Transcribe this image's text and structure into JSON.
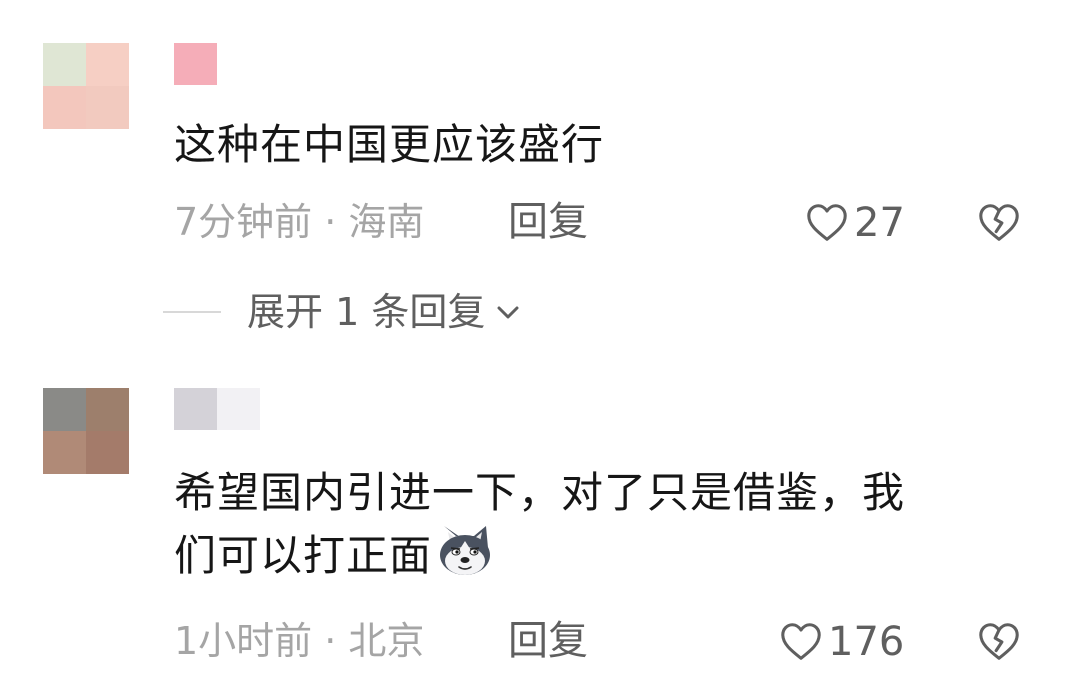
{
  "comments": [
    {
      "text": "这种在中国更应该盛行",
      "time_location": "7分钟前 · 海南",
      "reply_label": "回复",
      "like_count": "27",
      "expand_label": "展开 1 条回复",
      "avatar_colors": [
        "#dfe6d4",
        "#f6cfc4",
        "#f3c7bd",
        "#f2cabf"
      ],
      "username_colors": [
        "#f5adb8"
      ]
    },
    {
      "text_line1": "希望国内引进一下，对了只是借鉴，我",
      "text_line2": "们可以打正面",
      "time_location": "1小时前 · 北京",
      "reply_label": "回复",
      "like_count": "176",
      "avatar_colors": [
        "#8a8a87",
        "#9d7f6c",
        "#b08a77",
        "#a47b6a"
      ],
      "username_colors": [
        "#d4d2d8",
        "#f2f1f4"
      ]
    }
  ],
  "icons": {
    "like": "heart-outline-icon",
    "dislike": "broken-heart-icon",
    "expand": "chevron-down-icon",
    "emoji": "husky-dog-emoji-icon"
  },
  "colors": {
    "text": "#161616",
    "meta": "#a5a5a5",
    "action": "#5f5f5f"
  }
}
